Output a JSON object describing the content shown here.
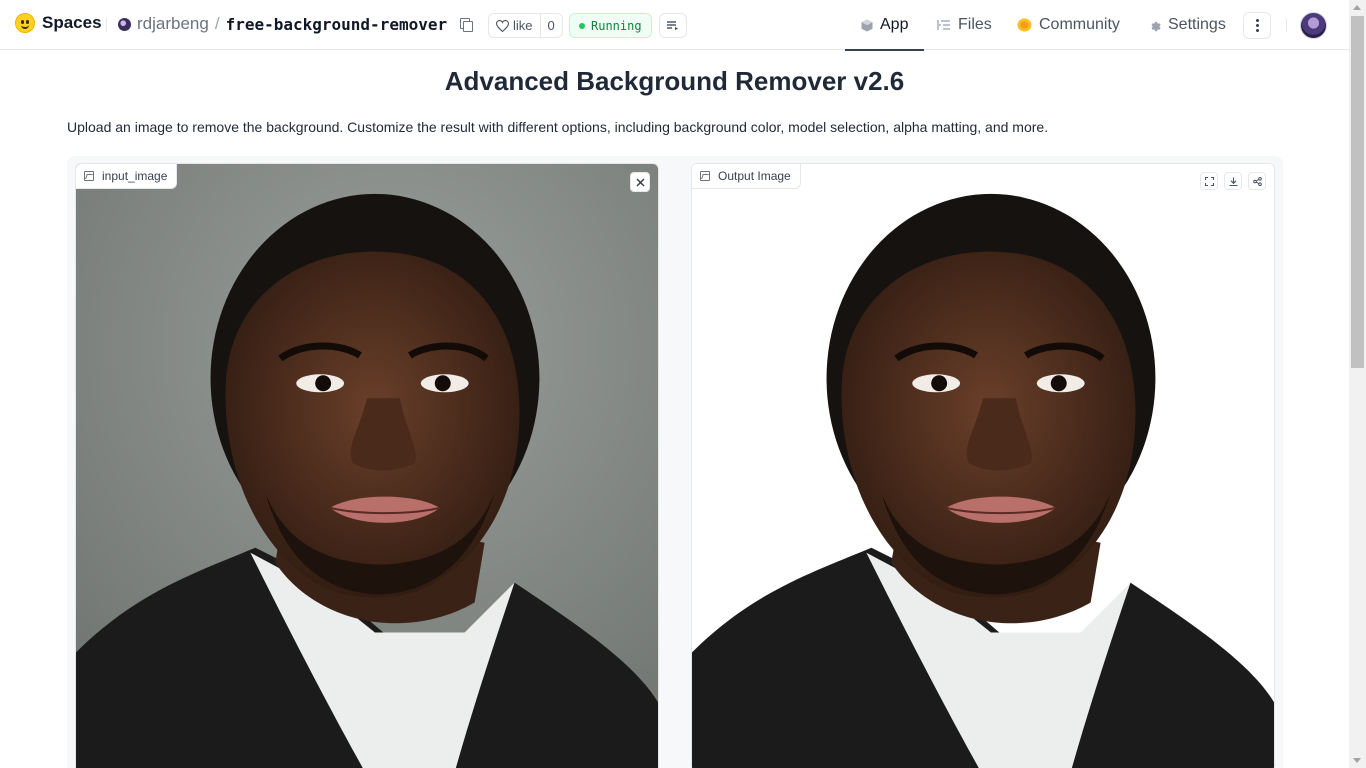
{
  "header": {
    "brand": "Spaces",
    "owner": "rdjarbeng",
    "repo_name": "free-background-remover",
    "like_label": "like",
    "like_count": "0",
    "status": "Running",
    "nav": [
      {
        "label": "App",
        "icon": "cube-icon"
      },
      {
        "label": "Files",
        "icon": "files-icon"
      },
      {
        "label": "Community",
        "icon": "community-icon"
      },
      {
        "label": "Settings",
        "icon": "gear-icon"
      }
    ]
  },
  "main": {
    "title": "Advanced Background Remover v2.6",
    "description": "Upload an image to remove the background. Customize the result with different options, including background color, model selection, alpha matting, and more.",
    "input_label": "input_image",
    "output_label": "Output Image"
  },
  "colors": {
    "status_green": "#22c55e",
    "photo_bg_input": "#8a8f8b",
    "photo_bg_output": "#ffffff"
  }
}
